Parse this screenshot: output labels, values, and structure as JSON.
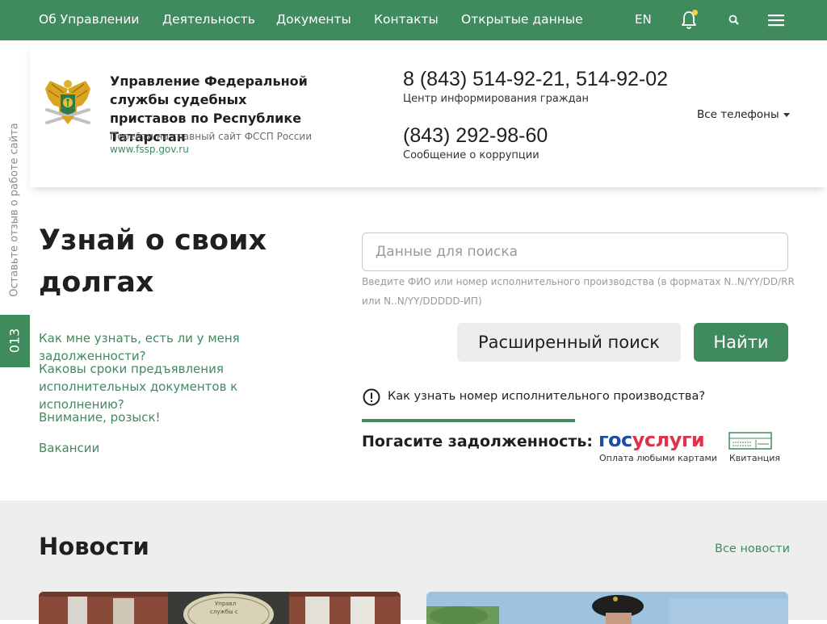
{
  "topnav": {
    "items": [
      "Об Управлении",
      "Деятельность",
      "Документы",
      "Контакты",
      "Открытые данные"
    ],
    "lang": "EN"
  },
  "header": {
    "title": "Управление Федеральной службы судебных приставов по Республике Татарстан",
    "subtitle": "Перейти на главный сайт ФССП России",
    "link": "www.fssp.gov.ru",
    "phone1": "8 (843) 514-92-21, 514-92-02",
    "phone1_label": "Центр информирования граждан",
    "phone2": "(843) 292-98-60",
    "phone2_label": "Сообщение о коррупции",
    "all_phones": "Все телефоны"
  },
  "side": {
    "feedback": "Оставьте отзыв о работе сайта",
    "tab_013": "013"
  },
  "debt": {
    "title": "Узнай о своих долгах",
    "links": [
      "Как мне узнать, есть ли у меня задолженности?",
      "Каковы сроки предъявления исполнительных документов к исполнению?",
      "Внимание, розыск!",
      "Вакансии"
    ]
  },
  "search": {
    "placeholder": "Данные для поиска",
    "hint": "Введите ФИО или номер исполнительного производства (в форматах N..N/YY/DD/RR или N..N/YY/DDDDD-ИП)",
    "advanced_label": "Расширенный поиск",
    "find_label": "Найти",
    "info_link": "Как узнать номер исполнительного производства?"
  },
  "pay": {
    "label": "Погасите задолженность:",
    "gos_part1": "гос",
    "gos_part2": "услуги",
    "gos_caption": "Оплата любыми картами",
    "receipt_caption": "Квитанция"
  },
  "news": {
    "title": "Новости",
    "all_label": "Все новости"
  },
  "colors": {
    "brand_green": "#3f8b5e",
    "gos_blue": "#1f4d9e",
    "gos_red": "#e0324b",
    "bell_dot": "#f2d43c"
  }
}
